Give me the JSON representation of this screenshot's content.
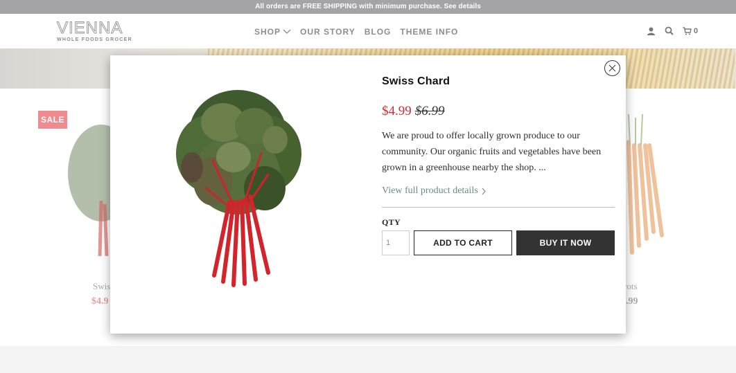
{
  "announcement": "All orders are FREE SHIPPING with minimum purchase. See details",
  "logo": {
    "name": "VIENNA",
    "tagline": "WHOLE FOODS GROCER"
  },
  "nav": {
    "shop": "SHOP",
    "our_story": "OUR STORY",
    "blog": "BLOG",
    "theme_info": "THEME INFO"
  },
  "header_icons": {
    "account": "user-icon",
    "search": "search-icon",
    "cart": "cart-icon",
    "cart_count": "0"
  },
  "background": {
    "sale_badge": "SALE",
    "left_product_name": "Swis",
    "left_product_price": "$4.9",
    "right_product_name": "rots",
    "right_product_price": ".99"
  },
  "modal": {
    "title": "Swiss Chard",
    "price_sale": "$4.99",
    "price_compare": "$6.99",
    "description": "We are proud to offer locally grown produce to our community. Our organic fruits and vegetables have been grown in a greenhouse nearby the shop. ...",
    "details_link": "View full product details",
    "qty_label": "QTY",
    "qty_value": "1",
    "add_to_cart": "ADD TO CART",
    "buy_now": "BUY IT NOW"
  },
  "colors": {
    "sale_price": "#d52b35",
    "sale_badge": "#f08a8e",
    "buy_button": "#333333",
    "link": "#6a8a88",
    "announcement_bar": "#a4a4a8"
  }
}
